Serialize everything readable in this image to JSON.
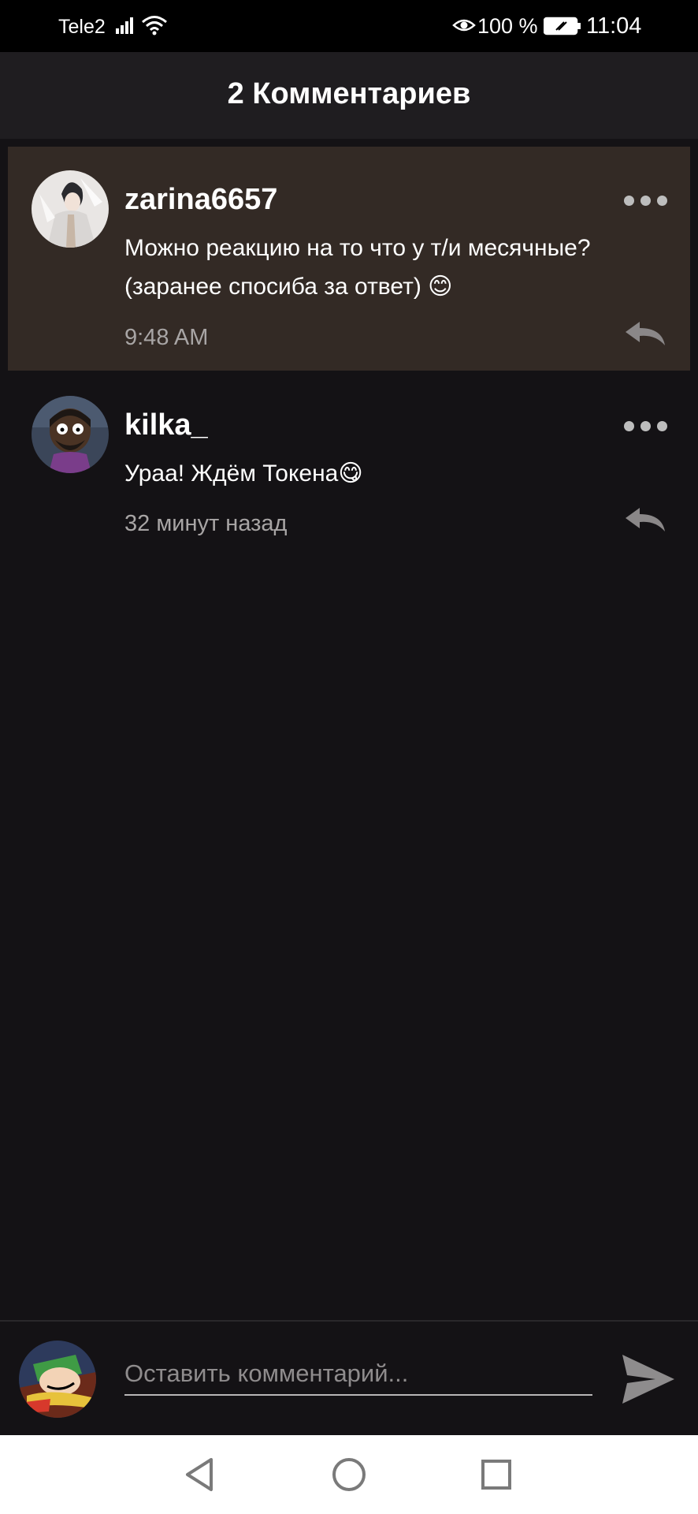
{
  "status_bar": {
    "carrier": "Tele2",
    "battery_percent": "100 %",
    "time": "11:04"
  },
  "header": {
    "title": "2 Комментариев"
  },
  "comments": [
    {
      "username": "zarina6657",
      "text_line1": "Можно реакцию на то что у т/и месячные?",
      "text_line2": "(заранее спосиба за ответ) 😊",
      "time": "9:48 AM",
      "highlighted": true
    },
    {
      "username": "kilka_",
      "text_line1": "Ураа! Ждём Токена😋",
      "time": "32 минут назад",
      "highlighted": false
    }
  ],
  "composer": {
    "placeholder": "Оставить комментарий..."
  },
  "colors": {
    "background": "#141215",
    "header": "#1f1d20",
    "highlight": "#332a25",
    "muted_text": "#a8a5a5"
  }
}
